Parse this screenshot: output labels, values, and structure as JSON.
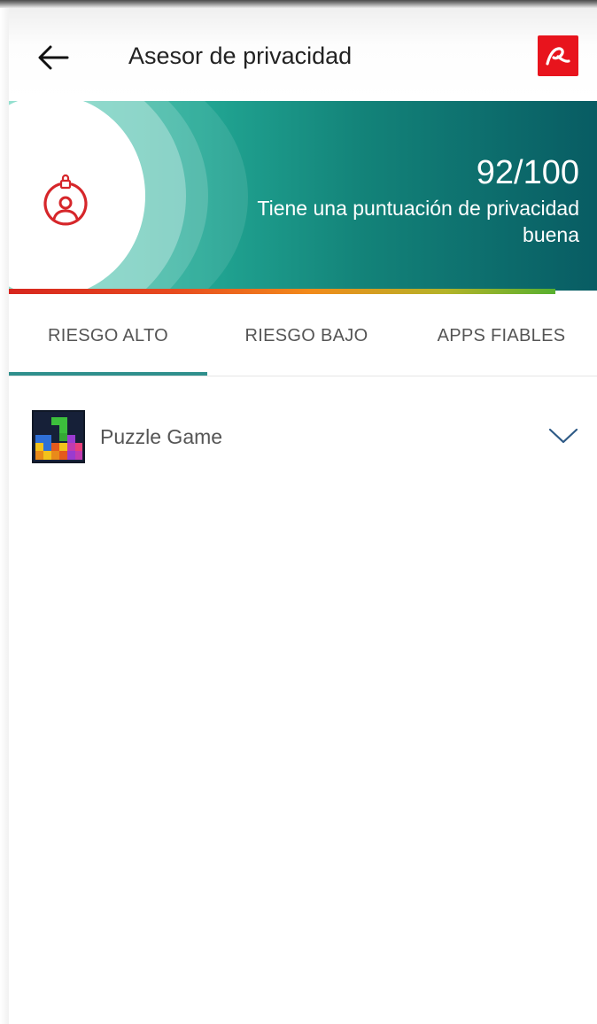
{
  "header": {
    "title": "Asesor de privacidad",
    "back_icon": "arrow-left-icon",
    "logo_icon": "avira-logo-icon",
    "logo_color": "#e8141d"
  },
  "banner": {
    "score": "92/100",
    "description": "Tiene una puntuación de privacidad buena",
    "icon": "privacy-lock-user-icon",
    "risk_level": 0.92
  },
  "tabs": [
    {
      "label": "RIESGO ALTO",
      "selected": true
    },
    {
      "label": "RIESGO BAJO",
      "selected": false
    },
    {
      "label": "APPS FIABLES",
      "selected": false
    }
  ],
  "apps": [
    {
      "name": "Puzzle Game",
      "icon": "puzzle-game-icon",
      "expand_icon": "chevron-down-icon"
    }
  ],
  "colors": {
    "accent": "#2f8f8c",
    "text": "#555555",
    "alert": "#e8141d"
  }
}
